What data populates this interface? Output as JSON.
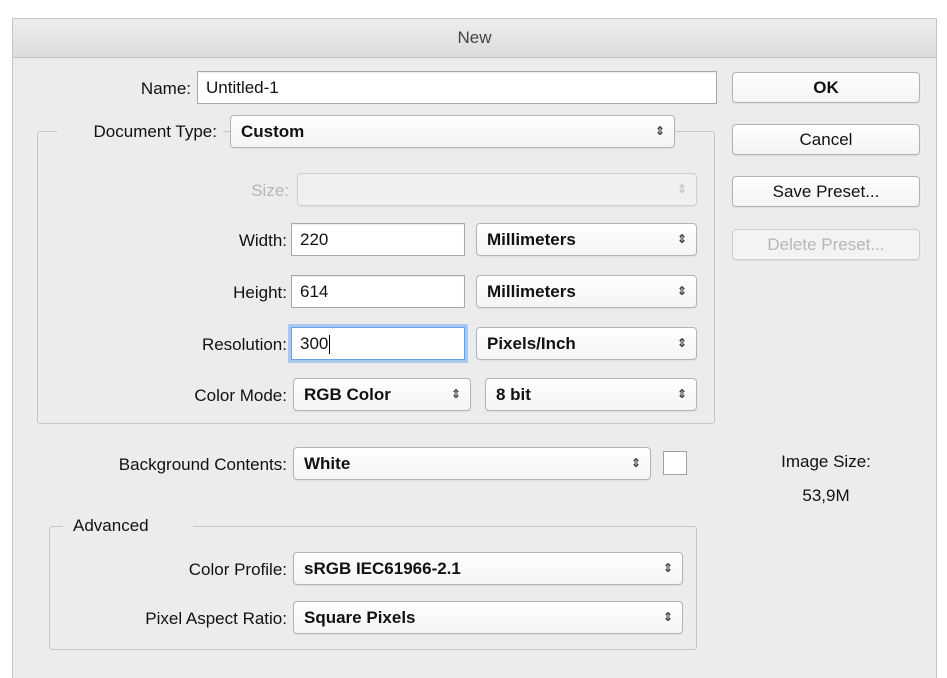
{
  "window": {
    "title": "New"
  },
  "name": {
    "label": "Name:",
    "value": "Untitled-1"
  },
  "document_type": {
    "label": "Document Type:",
    "value": "Custom"
  },
  "size": {
    "label": "Size:",
    "value": ""
  },
  "width": {
    "label": "Width:",
    "value": "220",
    "unit": "Millimeters"
  },
  "height": {
    "label": "Height:",
    "value": "614",
    "unit": "Millimeters"
  },
  "resolution": {
    "label": "Resolution:",
    "value": "300",
    "unit": "Pixels/Inch"
  },
  "color_mode": {
    "label": "Color Mode:",
    "value": "RGB Color",
    "depth": "8 bit"
  },
  "background": {
    "label": "Background Contents:",
    "value": "White",
    "swatch_color": "#ffffff"
  },
  "advanced": {
    "label": "Advanced",
    "color_profile": {
      "label": "Color Profile:",
      "value": "sRGB IEC61966-2.1"
    },
    "pixel_aspect": {
      "label": "Pixel Aspect Ratio:",
      "value": "Square Pixels"
    }
  },
  "buttons": {
    "ok": "OK",
    "cancel": "Cancel",
    "save_preset": "Save Preset...",
    "delete_preset": "Delete Preset..."
  },
  "image_size": {
    "label": "Image Size:",
    "value": "53,9M"
  },
  "icons": {
    "popup_arrow": "⇕"
  }
}
